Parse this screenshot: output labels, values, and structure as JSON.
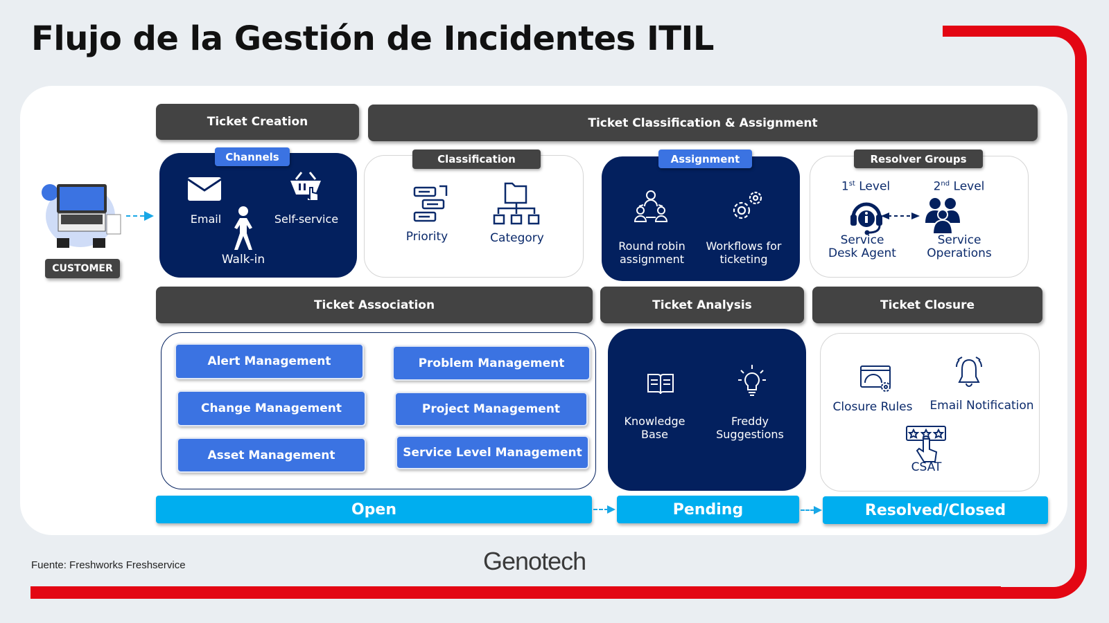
{
  "title": "Flujo de la Gestión de Incidentes ITIL",
  "colors": {
    "brand_red": "#e30613",
    "navy": "#03205e",
    "button_blue": "#3b73e2",
    "status_cyan": "#00aeef",
    "header_gray": "#434343"
  },
  "customer": {
    "label": "CUSTOMER",
    "icon": "laptop-user-icon"
  },
  "headers": {
    "ticket_creation": "Ticket Creation",
    "classification_assignment": "Ticket Classification & Assignment",
    "association": "Ticket Association",
    "analysis": "Ticket Analysis",
    "closure": "Ticket Closure"
  },
  "channels": {
    "tag": "Channels",
    "email": "Email",
    "self_service": "Self-service",
    "walk_in": "Walk-in"
  },
  "classification": {
    "tag": "Classification",
    "priority": "Priority",
    "category": "Category"
  },
  "assignment": {
    "tag": "Assignment",
    "round_robin": "Round robin\nassignment",
    "workflows": "Workflows for\nticketing"
  },
  "resolver": {
    "tag": "Resolver Groups",
    "level1_num": "1",
    "level1_sup": "st",
    "level2_num": "2",
    "level2_sup": "nd",
    "level_word": "Level",
    "agent": "Service\nDesk Agent",
    "operations": "Service\nOperations"
  },
  "association_items": [
    "Alert Management",
    "Problem Management",
    "Change Management",
    "Project Management",
    "Asset Management",
    "Service Level Management"
  ],
  "analysis": {
    "kb": "Knowledge\nBase",
    "freddy": "Freddy\nSuggestions"
  },
  "closure": {
    "rules": "Closure Rules",
    "email": "Email Notification",
    "csat": "CSAT"
  },
  "statuses": [
    "Open",
    "Pending",
    "Resolved/Closed"
  ],
  "footer": {
    "source": "Fuente: Freshworks Freshservice",
    "logo": "Genotech"
  }
}
